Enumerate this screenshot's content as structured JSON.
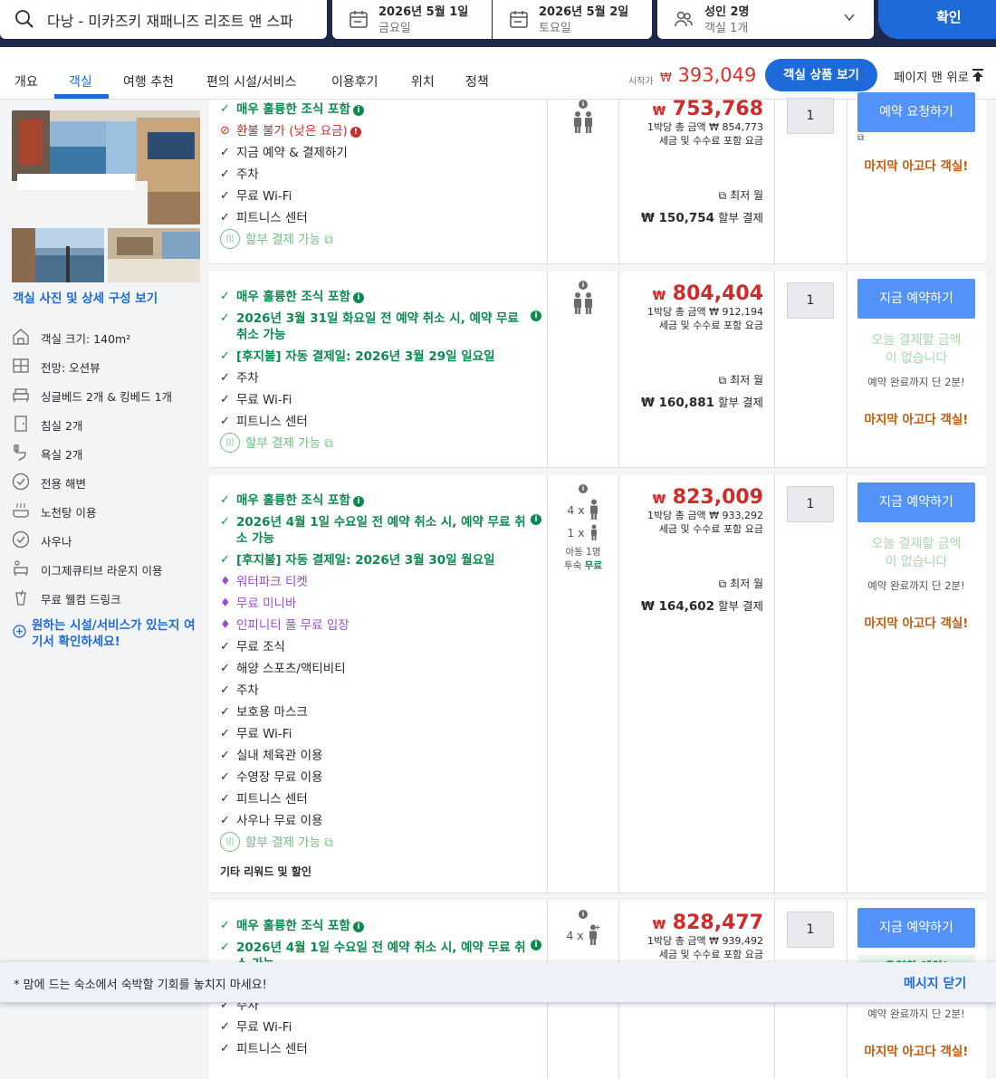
{
  "search": {
    "destination": "다낭 - 미카즈키 재패니즈 리조트 앤 스파",
    "checkin_date": "2026년 5월 1일",
    "checkin_day": "금요일",
    "checkout_date": "2026년 5월 2일",
    "checkout_day": "토요일",
    "guests": "성인 2명",
    "rooms": "객실 1개",
    "confirm_label": "확인"
  },
  "nav": {
    "tabs": [
      "개요",
      "객실",
      "여행 추천",
      "편의 시설/서비스",
      "이용후기",
      "위치",
      "정책"
    ],
    "active_tab": "객실",
    "from_label": "시작가",
    "from_currency": "₩",
    "from_price": "393,049",
    "view_rooms_label": "객실 상품 보기",
    "top_label": "페이지 맨 위로"
  },
  "room": {
    "photos_link": "객실 사진 및 상세 구성 보기",
    "features": [
      {
        "icon": "room-size-icon",
        "label": "객실 크기: 140m²"
      },
      {
        "icon": "view-icon",
        "label": "전망: 오션뷰"
      },
      {
        "icon": "bed-icon",
        "label": "싱글베드 2개 & 킹베드 1개"
      },
      {
        "icon": "bedroom-icon",
        "label": "침실 2개"
      },
      {
        "icon": "bathroom-icon",
        "label": "욕실 2개"
      },
      {
        "icon": "check-circle-icon",
        "label": "전용 해변"
      },
      {
        "icon": "hot-tub-icon",
        "label": "노천탕 이용"
      },
      {
        "icon": "check-circle-icon",
        "label": "사우나"
      },
      {
        "icon": "lounge-icon",
        "label": "이그제큐티브 라운지 이용"
      },
      {
        "icon": "welcome-drink-icon",
        "label": "무료 웰컴 드링크"
      }
    ],
    "want_link": "원하는 시설/서비스가 있는지 여기서 확인하세요!"
  },
  "offers": [
    {
      "perks": [
        {
          "type": "green-info",
          "text": "매우 훌륭한 조식 포함"
        },
        {
          "type": "red",
          "text": "환불 불가 (낮은 요금)"
        },
        {
          "type": "plain",
          "text": "지금 예약 & 결제하기"
        },
        {
          "type": "plain",
          "text": "주차"
        },
        {
          "type": "plain",
          "text": "무료 Wi-Fi"
        },
        {
          "type": "plain",
          "text": "피트니스 센터"
        },
        {
          "type": "installment",
          "text": "할부 결제 가능"
        }
      ],
      "currency": "₩",
      "price": "753,768",
      "total": "1박당 총 금액 ₩ 854,773",
      "tax_note": "세금 및 수수료 포함 요금",
      "installment_label": "최저 월",
      "installment_amount": "₩ 150,754",
      "installment_suffix": "할부 결제",
      "qty": "1",
      "button": "예약 요청하기",
      "last_room": "마지막 아고다 객실!"
    },
    {
      "perks": [
        {
          "type": "green-info",
          "text": "매우 훌륭한 조식 포함"
        },
        {
          "type": "green-info",
          "text": "2026년 3월 31일 화요일 전 예약 취소 시, 예약 무료 취소 가능"
        },
        {
          "type": "green",
          "text": "[후지불] 자동 결제일: 2026년 3월 29일 일요일"
        },
        {
          "type": "plain",
          "text": "주차"
        },
        {
          "type": "plain",
          "text": "무료 Wi-Fi"
        },
        {
          "type": "plain",
          "text": "피트니스 센터"
        },
        {
          "type": "installment",
          "text": "할부 결제 가능"
        }
      ],
      "currency": "₩",
      "price": "804,404",
      "total": "1박당 총 금액 ₩ 912,194",
      "tax_note": "세금 및 수수료 포함 요금",
      "installment_label": "최저 월",
      "installment_amount": "₩ 160,881",
      "installment_suffix": "할부 결제",
      "qty": "1",
      "button": "지금 예약하기",
      "no_payment": "오늘 결제할 금액이 없습니다",
      "fast_note": "예약 완료까지 단 2분!",
      "last_room": "마지막 아고다 객실!"
    },
    {
      "perks": [
        {
          "type": "green-info",
          "text": "매우 훌륭한 조식 포함"
        },
        {
          "type": "green-info",
          "text": "2026년 4월 1일 수요일 전 예약 취소 시, 예약 무료 취소 가능"
        },
        {
          "type": "green",
          "text": "[후지불] 자동 결제일: 2026년 3월 30일 월요일"
        },
        {
          "type": "purple",
          "text": "워터파크 티켓"
        },
        {
          "type": "purple",
          "text": "무료 미니바"
        },
        {
          "type": "purple",
          "text": "인피니티 풀 무료 입장"
        },
        {
          "type": "plain",
          "text": "무료 조식"
        },
        {
          "type": "plain",
          "text": "해양 스포츠/액티비티"
        },
        {
          "type": "plain",
          "text": "주차"
        },
        {
          "type": "plain",
          "text": "보호용 마스크"
        },
        {
          "type": "plain",
          "text": "무료 Wi-Fi"
        },
        {
          "type": "plain",
          "text": "실내 체육관 이용"
        },
        {
          "type": "plain",
          "text": "수영장 무료 이용"
        },
        {
          "type": "plain",
          "text": "피트니스 센터"
        },
        {
          "type": "plain",
          "text": "사우나 무료 이용"
        },
        {
          "type": "installment",
          "text": "할부 결제 가능"
        }
      ],
      "rewards": "기타 리워드 및 할인",
      "occupancy_adults": "4 x",
      "occupancy_children": "1 x",
      "child_note": "아동 1명",
      "child_stay": "투숙",
      "child_free": "무료",
      "currency": "₩",
      "price": "823,009",
      "total": "1박당 총 금액 ₩ 933,292",
      "tax_note": "세금 및 수수료 포함 요금",
      "installment_label": "최저 월",
      "installment_amount": "₩ 164,602",
      "installment_suffix": "할부 결제",
      "qty": "1",
      "button": "지금 예약하기",
      "no_payment": "오늘 결제할 금액이 없습니다",
      "fast_note": "예약 완료까지 단 2분!",
      "last_room": "마지막 아고다 객실!"
    },
    {
      "perks": [
        {
          "type": "green-info",
          "text": "매우 훌륭한 조식 포함"
        },
        {
          "type": "green-info",
          "text": "2026년 4월 1일 수요일 전 예약 취소 시, 예약 무료 취소 가능"
        },
        {
          "type": "plain",
          "text": "주차"
        },
        {
          "type": "plain",
          "text": "무료 Wi-Fi"
        },
        {
          "type": "plain",
          "text": "피트니스 센터"
        }
      ],
      "occupancy_adults": "4 x",
      "currency": "₩",
      "price": "828,477",
      "total": "1박당 총 금액 ₩ 939,492",
      "tax_note": "세금 및 수수료 포함 요금",
      "qty": "1",
      "button": "지금 예약하기",
      "flexible": "유연한 예약!",
      "fast_note": "예약 완료까지 단 2분!",
      "last_room": "마지막 아고다 객실!"
    }
  ],
  "banner": {
    "text": "* 맘에 드는 숙소에서 숙박할 기회를 놓치지 마세요!",
    "close": "메시지 닫기"
  },
  "colors": {
    "brand_blue": "#1e6ad8",
    "price_red": "#d02b2b",
    "perk_green": "#0c8a4f",
    "last_room_orange": "#c3590a"
  }
}
